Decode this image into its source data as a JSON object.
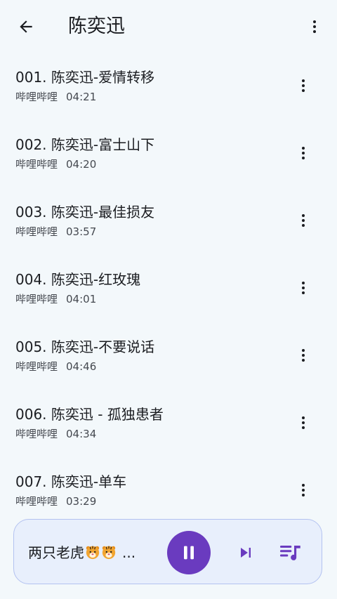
{
  "header": {
    "title": "陈奕迅",
    "back_icon": "arrow-back-icon",
    "more_icon": "more-vert-icon"
  },
  "songs": [
    {
      "title": "001. 陈奕迅-爱情转移",
      "source": "哔哩哔哩",
      "duration": "04:21"
    },
    {
      "title": "002. 陈奕迅-富士山下",
      "source": "哔哩哔哩",
      "duration": "04:20"
    },
    {
      "title": "003. 陈奕迅-最佳损友",
      "source": "哔哩哔哩",
      "duration": "03:57"
    },
    {
      "title": "004. 陈奕迅-红玫瑰",
      "source": "哔哩哔哩",
      "duration": "04:01"
    },
    {
      "title": "005. 陈奕迅-不要说话",
      "source": "哔哩哔哩",
      "duration": "04:46"
    },
    {
      "title": "006. 陈奕迅 - 孤独患者",
      "source": "哔哩哔哩",
      "duration": "04:34"
    },
    {
      "title": "007. 陈奕迅-单车",
      "source": "哔哩哔哩",
      "duration": "03:29"
    }
  ],
  "player": {
    "now_playing": "两只老虎",
    "ellipsis": "...",
    "state": "playing",
    "icons": [
      "tiger-emoji-icon",
      "pause-icon",
      "skip-next-icon",
      "queue-music-icon"
    ],
    "accent_color": "#6a3bbf",
    "background_color": "#e8effc"
  }
}
